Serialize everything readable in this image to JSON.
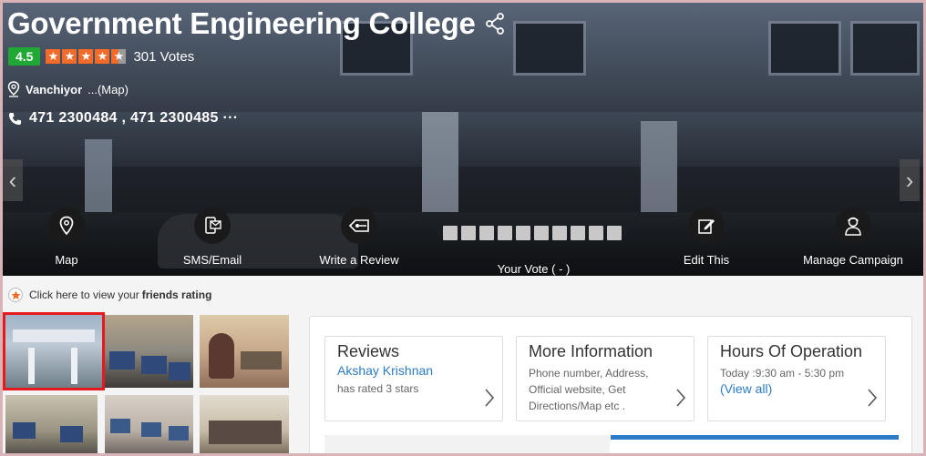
{
  "college": {
    "name": "Government Engineering College",
    "rating": "4.5",
    "stars": 4.5,
    "votes": "301 Votes",
    "location": "Vanchiyor",
    "map_link": "...(Map)",
    "phones": "471 2300484 , 471 2300485 ···"
  },
  "actions": {
    "map": "Map",
    "sms_email": "SMS/Email",
    "write_review": "Write a Review",
    "your_vote": "Your Vote ( - )",
    "edit_this": "Edit This",
    "manage_campaign": "Manage Campaign"
  },
  "vote": {
    "box_count": 10
  },
  "friends": {
    "text": "Click here to view your",
    "bold": "friends rating"
  },
  "info": {
    "reviews": {
      "title": "Reviews",
      "reviewer": "Akshay Krishnan",
      "detail": "has rated 3 stars"
    },
    "more": {
      "title": "More Information",
      "detail": "Phone number, Address, Official website, Get Directions/Map etc ."
    },
    "hours": {
      "title": "Hours Of Operation",
      "detail": "Today :9:30 am - 5:30 pm",
      "link": "(View all)"
    }
  },
  "colors": {
    "rating_green": "#1fa834",
    "star_orange": "#f26b2b",
    "link_blue": "#2b7bc6",
    "selected_red": "#e5191e"
  },
  "icons": [
    "share-icon",
    "location-icon",
    "phone-icon",
    "map-pin-icon",
    "sms-email-icon",
    "write-review-icon",
    "edit-icon",
    "manage-campaign-icon",
    "chevron-right-icon",
    "star-icon"
  ]
}
